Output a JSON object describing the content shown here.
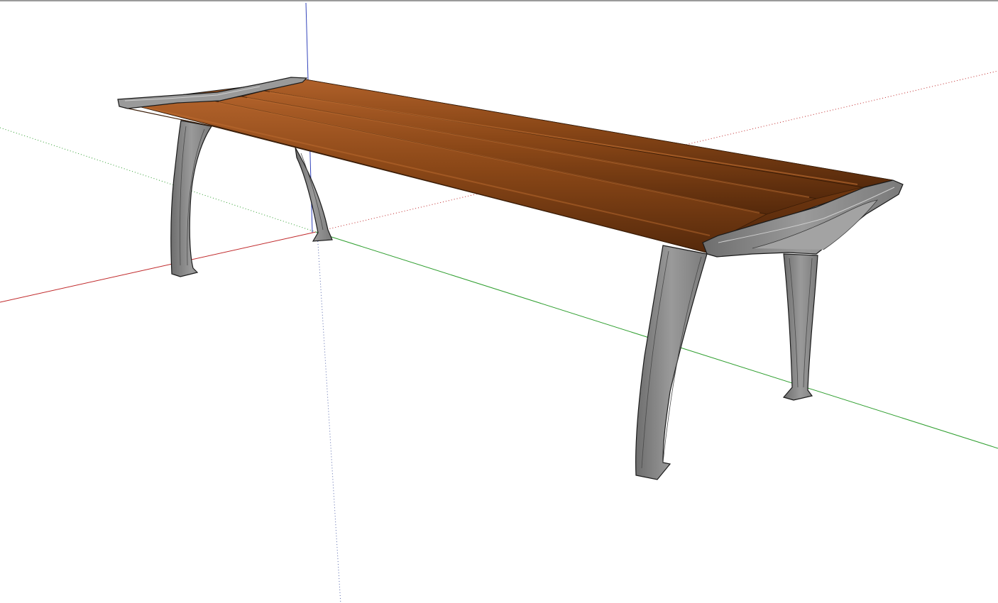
{
  "viewport": {
    "background": "#ffffff",
    "frame_color": "#9a9a9a"
  },
  "axes": {
    "red_axis_color": "#c0292b",
    "green_axis_color": "#2e9e2e",
    "blue_axis_color": "#3344bb"
  },
  "model": {
    "name": "bench",
    "wood_color": "#7a3d12",
    "wood_highlight": "#a8581f",
    "wood_shadow": "#4e250a",
    "metal_color": "#8a8a8a",
    "metal_dark": "#5a5a5a",
    "metal_light": "#b9b9b9",
    "edge_color": "#1a1a1a"
  }
}
